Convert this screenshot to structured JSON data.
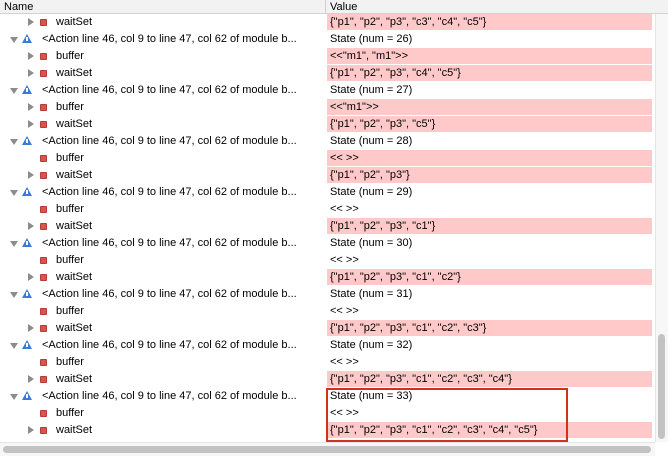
{
  "columns": {
    "name": "Name",
    "value": "Value"
  },
  "rows": [
    {
      "level": 1,
      "expander": "right",
      "icon": "record",
      "name": "waitSet",
      "value": "{\"p1\", \"p2\", \"p3\", \"c3\", \"c4\", \"c5\"}",
      "hl": true
    },
    {
      "level": 0,
      "expander": "down",
      "icon": "warning",
      "name": "<Action line 46, col 9 to line 47, col 62 of module b...",
      "value": "State (num = 26)",
      "hl": false
    },
    {
      "level": 1,
      "expander": "right",
      "icon": "record",
      "name": "buffer",
      "value": "<<\"m1\", \"m1\">>",
      "hl": true
    },
    {
      "level": 1,
      "expander": "right",
      "icon": "record",
      "name": "waitSet",
      "value": "{\"p1\", \"p2\", \"p3\", \"c4\", \"c5\"}",
      "hl": true
    },
    {
      "level": 0,
      "expander": "down",
      "icon": "warning",
      "name": "<Action line 46, col 9 to line 47, col 62 of module b...",
      "value": "State (num = 27)",
      "hl": false
    },
    {
      "level": 1,
      "expander": "right",
      "icon": "record",
      "name": "buffer",
      "value": "<<\"m1\">>",
      "hl": true
    },
    {
      "level": 1,
      "expander": "right",
      "icon": "record",
      "name": "waitSet",
      "value": "{\"p1\", \"p2\", \"p3\", \"c5\"}",
      "hl": true
    },
    {
      "level": 0,
      "expander": "down",
      "icon": "warning",
      "name": "<Action line 46, col 9 to line 47, col 62 of module b...",
      "value": "State (num = 28)",
      "hl": false
    },
    {
      "level": 1,
      "expander": "none",
      "icon": "record",
      "name": "buffer",
      "value": "<< >>",
      "hl": true
    },
    {
      "level": 1,
      "expander": "right",
      "icon": "record",
      "name": "waitSet",
      "value": "{\"p1\", \"p2\", \"p3\"}",
      "hl": true
    },
    {
      "level": 0,
      "expander": "down",
      "icon": "warning",
      "name": "<Action line 46, col 9 to line 47, col 62 of module b...",
      "value": "State (num = 29)",
      "hl": false
    },
    {
      "level": 1,
      "expander": "none",
      "icon": "record",
      "name": "buffer",
      "value": "<< >>",
      "hl": false
    },
    {
      "level": 1,
      "expander": "right",
      "icon": "record",
      "name": "waitSet",
      "value": "{\"p1\", \"p2\", \"p3\", \"c1\"}",
      "hl": true
    },
    {
      "level": 0,
      "expander": "down",
      "icon": "warning",
      "name": "<Action line 46, col 9 to line 47, col 62 of module b...",
      "value": "State (num = 30)",
      "hl": false
    },
    {
      "level": 1,
      "expander": "none",
      "icon": "record",
      "name": "buffer",
      "value": "<< >>",
      "hl": false
    },
    {
      "level": 1,
      "expander": "right",
      "icon": "record",
      "name": "waitSet",
      "value": "{\"p1\", \"p2\", \"p3\", \"c1\", \"c2\"}",
      "hl": true
    },
    {
      "level": 0,
      "expander": "down",
      "icon": "warning",
      "name": "<Action line 46, col 9 to line 47, col 62 of module b...",
      "value": "State (num = 31)",
      "hl": false
    },
    {
      "level": 1,
      "expander": "none",
      "icon": "record",
      "name": "buffer",
      "value": "<< >>",
      "hl": false
    },
    {
      "level": 1,
      "expander": "right",
      "icon": "record",
      "name": "waitSet",
      "value": "{\"p1\", \"p2\", \"p3\", \"c1\", \"c2\", \"c3\"}",
      "hl": true
    },
    {
      "level": 0,
      "expander": "down",
      "icon": "warning",
      "name": "<Action line 46, col 9 to line 47, col 62 of module b...",
      "value": "State (num = 32)",
      "hl": false
    },
    {
      "level": 1,
      "expander": "none",
      "icon": "record",
      "name": "buffer",
      "value": "<< >>",
      "hl": false
    },
    {
      "level": 1,
      "expander": "right",
      "icon": "record",
      "name": "waitSet",
      "value": "{\"p1\", \"p2\", \"p3\", \"c1\", \"c2\", \"c3\", \"c4\"}",
      "hl": true
    },
    {
      "level": 0,
      "expander": "down",
      "icon": "warning",
      "name": "<Action line 46, col 9 to line 47, col 62 of module b...",
      "value": "State (num = 33)",
      "hl": false
    },
    {
      "level": 1,
      "expander": "none",
      "icon": "record",
      "name": "buffer",
      "value": "<< >>",
      "hl": false
    },
    {
      "level": 1,
      "expander": "right",
      "icon": "record",
      "name": "waitSet",
      "value": "{\"p1\", \"p2\", \"p3\", \"c1\", \"c2\", \"c3\", \"c4\", \"c5\"}",
      "hl": true
    }
  ],
  "colors": {
    "highlight": "#ffc9c9",
    "record_icon": "#d9534f",
    "warning_icon": "#3a7bd5",
    "selection_box": "#d0331d"
  }
}
